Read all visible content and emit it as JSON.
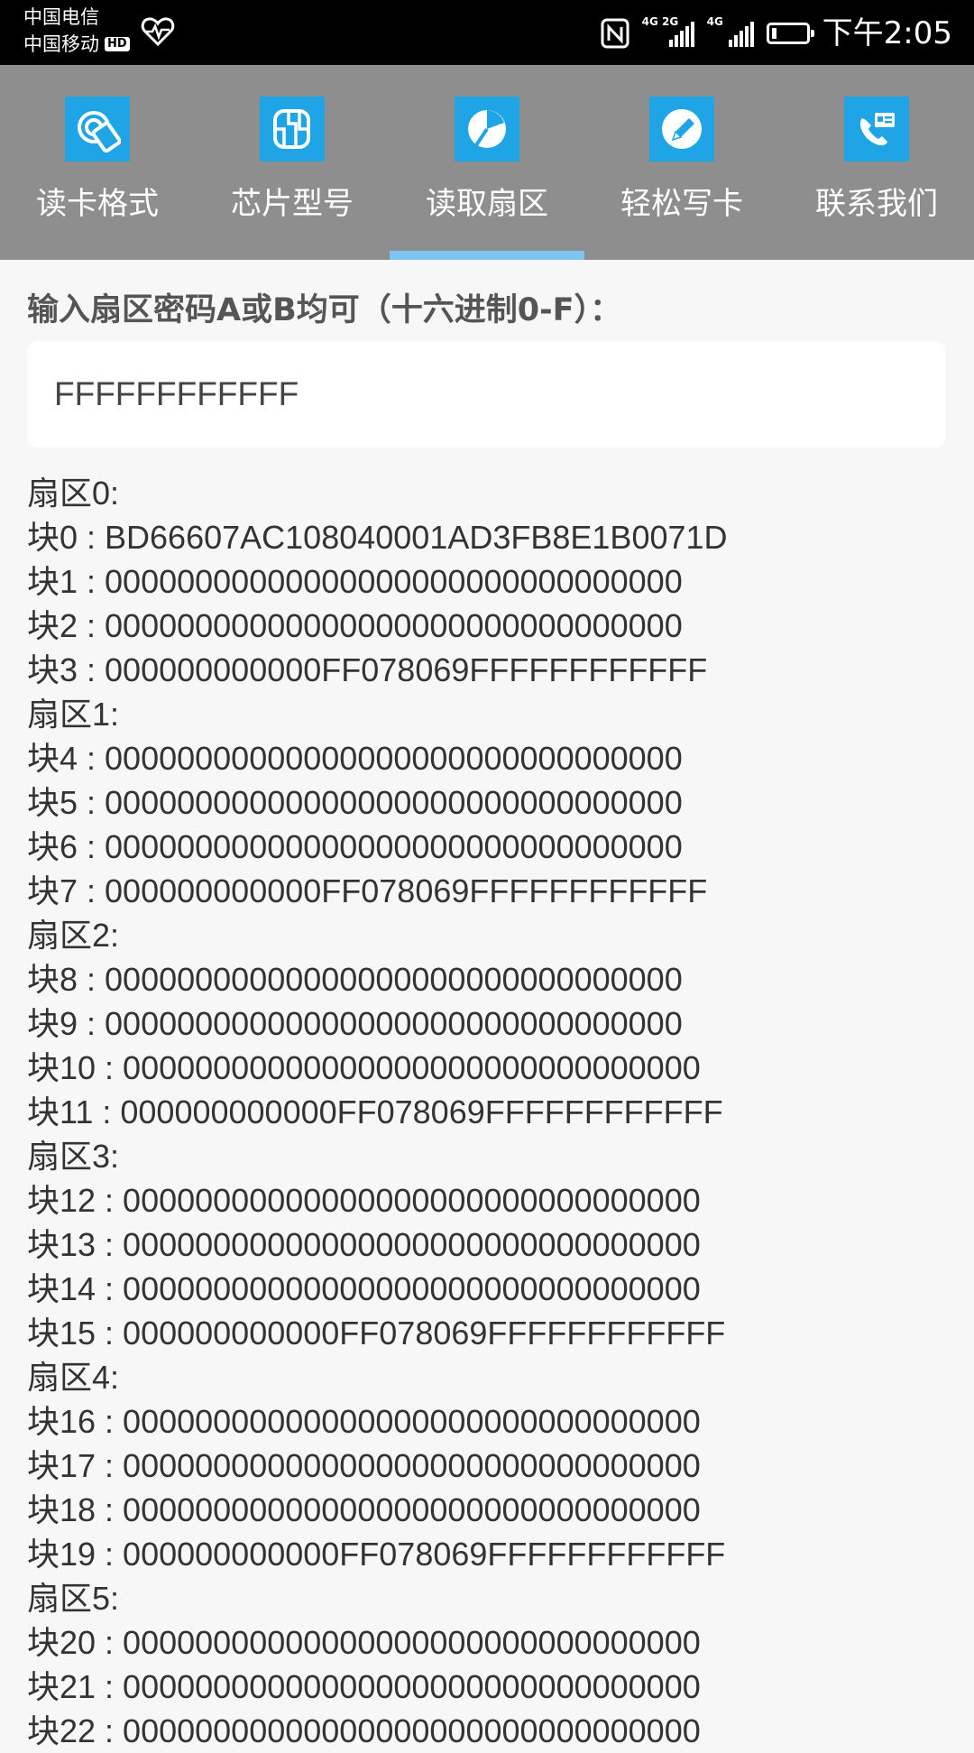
{
  "status_bar": {
    "carrier1": "中国电信",
    "carrier2": "中国移动",
    "hd": "HD",
    "net1": "4G 2G",
    "net2": "4G",
    "battery_level": 0.15,
    "time": "下午2:05"
  },
  "tabs": [
    {
      "label": "读卡格式",
      "icon": "read-format-icon",
      "active": false
    },
    {
      "label": "芯片型号",
      "icon": "chip-model-icon",
      "active": false
    },
    {
      "label": "读取扇区",
      "icon": "read-sector-icon",
      "active": true
    },
    {
      "label": "轻松写卡",
      "icon": "write-card-icon",
      "active": false
    },
    {
      "label": "联系我们",
      "icon": "contact-us-icon",
      "active": false
    }
  ],
  "colors": {
    "tab_bar": "#8e8e8e",
    "icon_bg": "#1fa4e6",
    "indicator": "#7ec5f1"
  },
  "main": {
    "prompt": "输入扇区密码A或B均可（十六进制0-F）：",
    "key_value": "FFFFFFFFFFFF",
    "dump_lines": [
      "扇区0:",
      "块0 : BD66607AC108040001AD3FB8E1B0071D",
      "块1 : 00000000000000000000000000000000",
      "块2 : 00000000000000000000000000000000",
      "块3 : 000000000000FF078069FFFFFFFFFFFF",
      "扇区1:",
      "块4 : 00000000000000000000000000000000",
      "块5 : 00000000000000000000000000000000",
      "块6 : 00000000000000000000000000000000",
      "块7 : 000000000000FF078069FFFFFFFFFFFF",
      "扇区2:",
      "块8 : 00000000000000000000000000000000",
      "块9 : 00000000000000000000000000000000",
      "块10 : 00000000000000000000000000000000",
      "块11 : 000000000000FF078069FFFFFFFFFFFF",
      "扇区3:",
      "块12 : 00000000000000000000000000000000",
      "块13 : 00000000000000000000000000000000",
      "块14 : 00000000000000000000000000000000",
      "块15 : 000000000000FF078069FFFFFFFFFFFF",
      "扇区4:",
      "块16 : 00000000000000000000000000000000",
      "块17 : 00000000000000000000000000000000",
      "块18 : 00000000000000000000000000000000",
      "块19 : 000000000000FF078069FFFFFFFFFFFF",
      "扇区5:",
      "块20 : 00000000000000000000000000000000",
      "块21 : 00000000000000000000000000000000",
      "块22 : 00000000000000000000000000000000"
    ]
  }
}
